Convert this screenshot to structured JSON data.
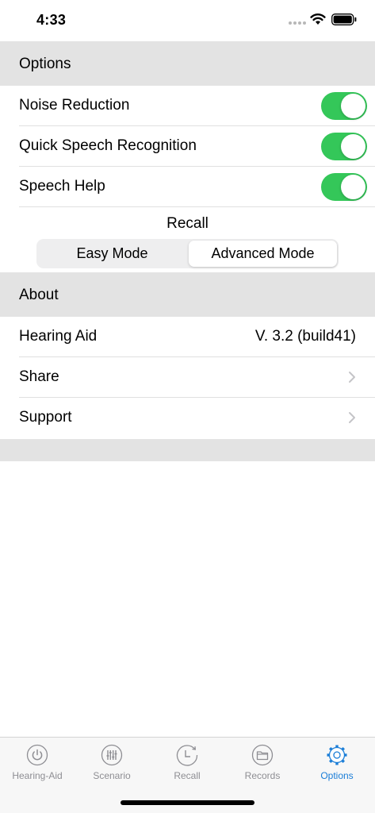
{
  "status_bar": {
    "time": "4:33"
  },
  "options": {
    "header": "Options",
    "items": [
      {
        "label": "Noise Reduction",
        "on": true
      },
      {
        "label": "Quick Speech Recognition",
        "on": true
      },
      {
        "label": "Speech Help",
        "on": true
      }
    ],
    "recall_label": "Recall",
    "modes": [
      "Easy Mode",
      "Advanced Mode"
    ],
    "selected_mode": "Advanced Mode"
  },
  "about": {
    "header": "About",
    "app_name": "Hearing Aid",
    "version": "V. 3.2 (build41)",
    "share": "Share",
    "support": "Support"
  },
  "tab_bar": {
    "tabs": [
      {
        "label": "Hearing-Aid",
        "icon": "power-icon"
      },
      {
        "label": "Scenario",
        "icon": "sliders-icon"
      },
      {
        "label": "Recall",
        "icon": "clock-icon"
      },
      {
        "label": "Records",
        "icon": "folder-icon"
      },
      {
        "label": "Options",
        "icon": "gear-icon"
      }
    ],
    "active": "Options"
  },
  "colors": {
    "toggle_on": "#34c759",
    "accent": "#1a7dd7",
    "section_bg": "#e3e3e3"
  }
}
